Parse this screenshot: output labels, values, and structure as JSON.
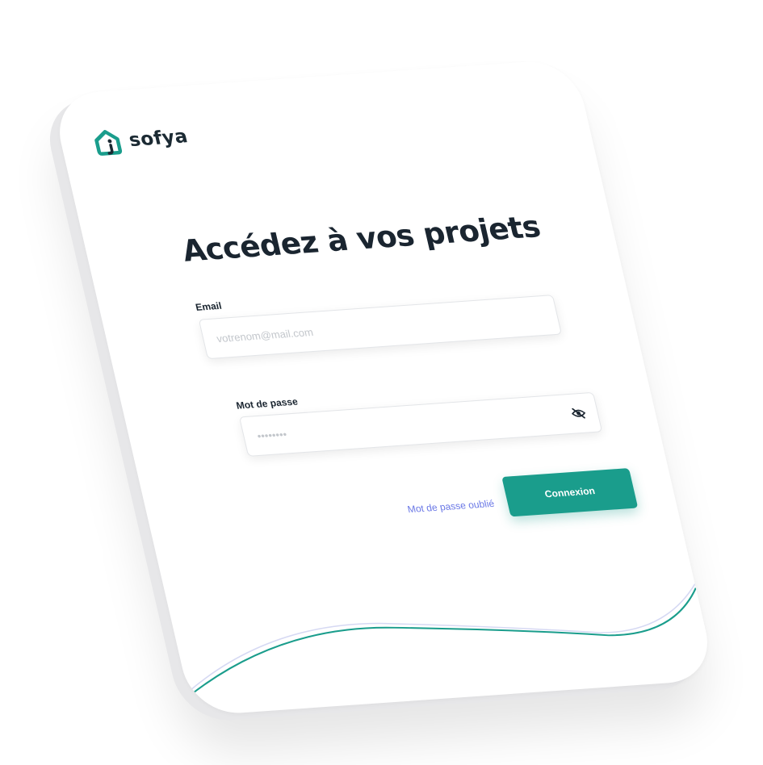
{
  "brand": {
    "name": "sofya",
    "accent": "#1a9d8c",
    "logo_icon": "house-icon"
  },
  "login": {
    "title": "Accédez à vos projets",
    "email_label": "Email",
    "email_placeholder": "votrenom@mail.com",
    "password_label": "Mot de passe",
    "password_placeholder": "••••••••",
    "password_toggle_icon": "eye-off-icon",
    "forgot_link": "Mot de passe oublié",
    "submit_label": "Connexion",
    "link_color": "#6a78e6"
  }
}
